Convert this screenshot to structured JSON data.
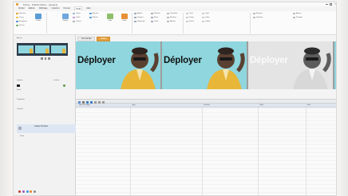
{
  "window": {
    "title": "Pictus - Publish Editor - [projet1]"
  },
  "menu": {
    "items": [
      "Fichier",
      "Edition",
      "Affichage",
      "Insertion",
      "Format",
      "Outils",
      "Aide"
    ],
    "active_index": 5
  },
  "ribbon": {
    "small_buttons": [
      "Nouveau",
      "Ouvrir",
      "Enregistrer",
      "Fermer",
      "Copier",
      "Coller",
      "Couper",
      "Annuler",
      "Refaire",
      "Aligner",
      "Grouper",
      "Dégrouper",
      "Rotation",
      "Miroir",
      "Ordre",
      "Verrouiller",
      "Masquer",
      "Afficher",
      "Texte",
      "Image",
      "Forme",
      "Ligne",
      "Cadre",
      "Calque",
      "Exporter",
      "Imprimer",
      "Aperçu",
      "Partager"
    ],
    "big_buttons": [
      "Publier",
      "Modèle",
      "Style",
      "Effets"
    ]
  },
  "left_panel": {
    "labels": [
      "Aperçu",
      "Options",
      "Couleur",
      "Fond",
      "Propriétés",
      "Calques"
    ],
    "selected_item": "Calque Principal",
    "sub_item": "Fond"
  },
  "tabs": [
    "Vue Canvas",
    "Edition"
  ],
  "canvas": {
    "banner_text": "Déployer",
    "accent": "#e6a13d",
    "banner_bg": "#8fd6de"
  },
  "table": {
    "headers": [
      "Nom de l'objet",
      "Type",
      "Position",
      "Taille",
      "Etat"
    ]
  }
}
